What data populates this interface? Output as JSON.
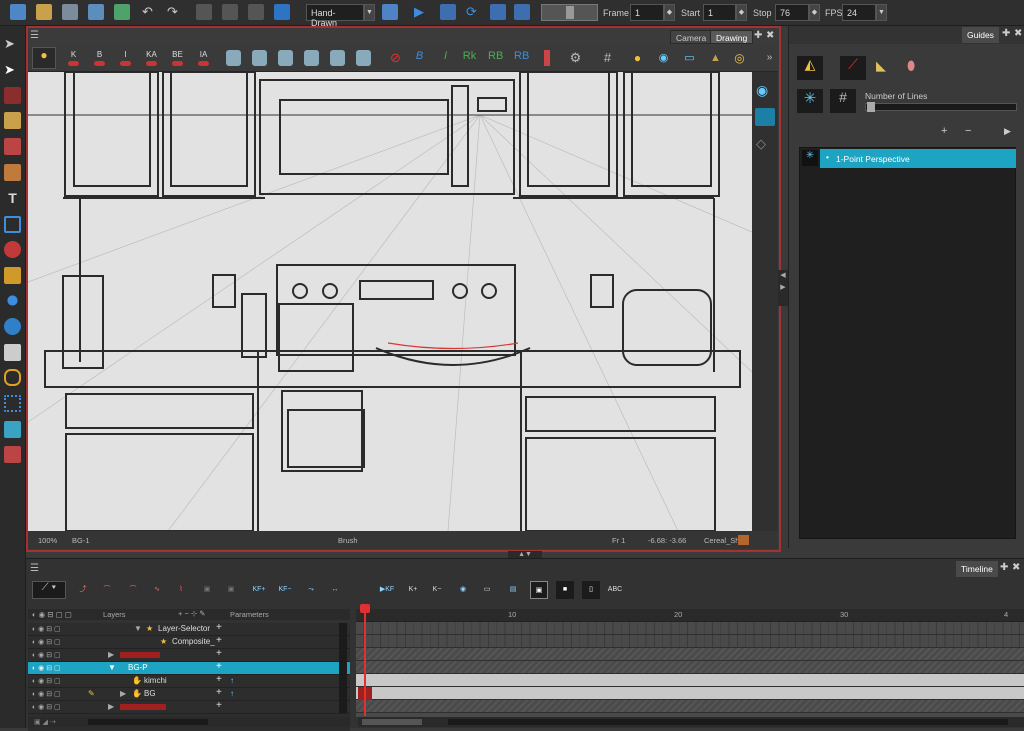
{
  "toolbar": {
    "mode": "Hand-Drawn",
    "frame_label": "Frame",
    "frame_value": "1",
    "start_label": "Start",
    "start_value": "1",
    "stop_label": "Stop",
    "stop_value": "76",
    "fps_label": "FPS",
    "fps_value": "24"
  },
  "view": {
    "tabs": [
      "Camera",
      "Drawing"
    ],
    "active_tab": "Drawing",
    "tool_letters": [
      "K",
      "B",
      "I",
      "KA",
      "BE",
      "IA"
    ],
    "color_letters": [
      "B",
      "I",
      "Rk",
      "RB",
      "RB"
    ]
  },
  "status": {
    "zoom": "100%",
    "drawing": "BG-1",
    "tool": "Brush",
    "frame": "Fr 1",
    "coords": "-6.68: -3.66",
    "palette": "Cereal_Sh"
  },
  "guides": {
    "title": "Guides",
    "number_of_lines_label": "Number of Lines",
    "items": [
      "1-Point Perspective"
    ]
  },
  "timeline": {
    "title": "Timeline",
    "layers_header": "Layers",
    "params_header": "Parameters",
    "ruler_marks": [
      "10",
      "20",
      "30",
      "4"
    ],
    "layers": [
      {
        "name": "Layer-Selector"
      },
      {
        "name": "Composite_"
      },
      {
        "name": ""
      },
      {
        "name": "BG-P"
      },
      {
        "name": "kimchi"
      },
      {
        "name": "BG"
      },
      {
        "name": ""
      }
    ]
  },
  "colors": {
    "accent": "#1da4c2",
    "frame_border": "#a33232",
    "playhead": "#e03030"
  }
}
